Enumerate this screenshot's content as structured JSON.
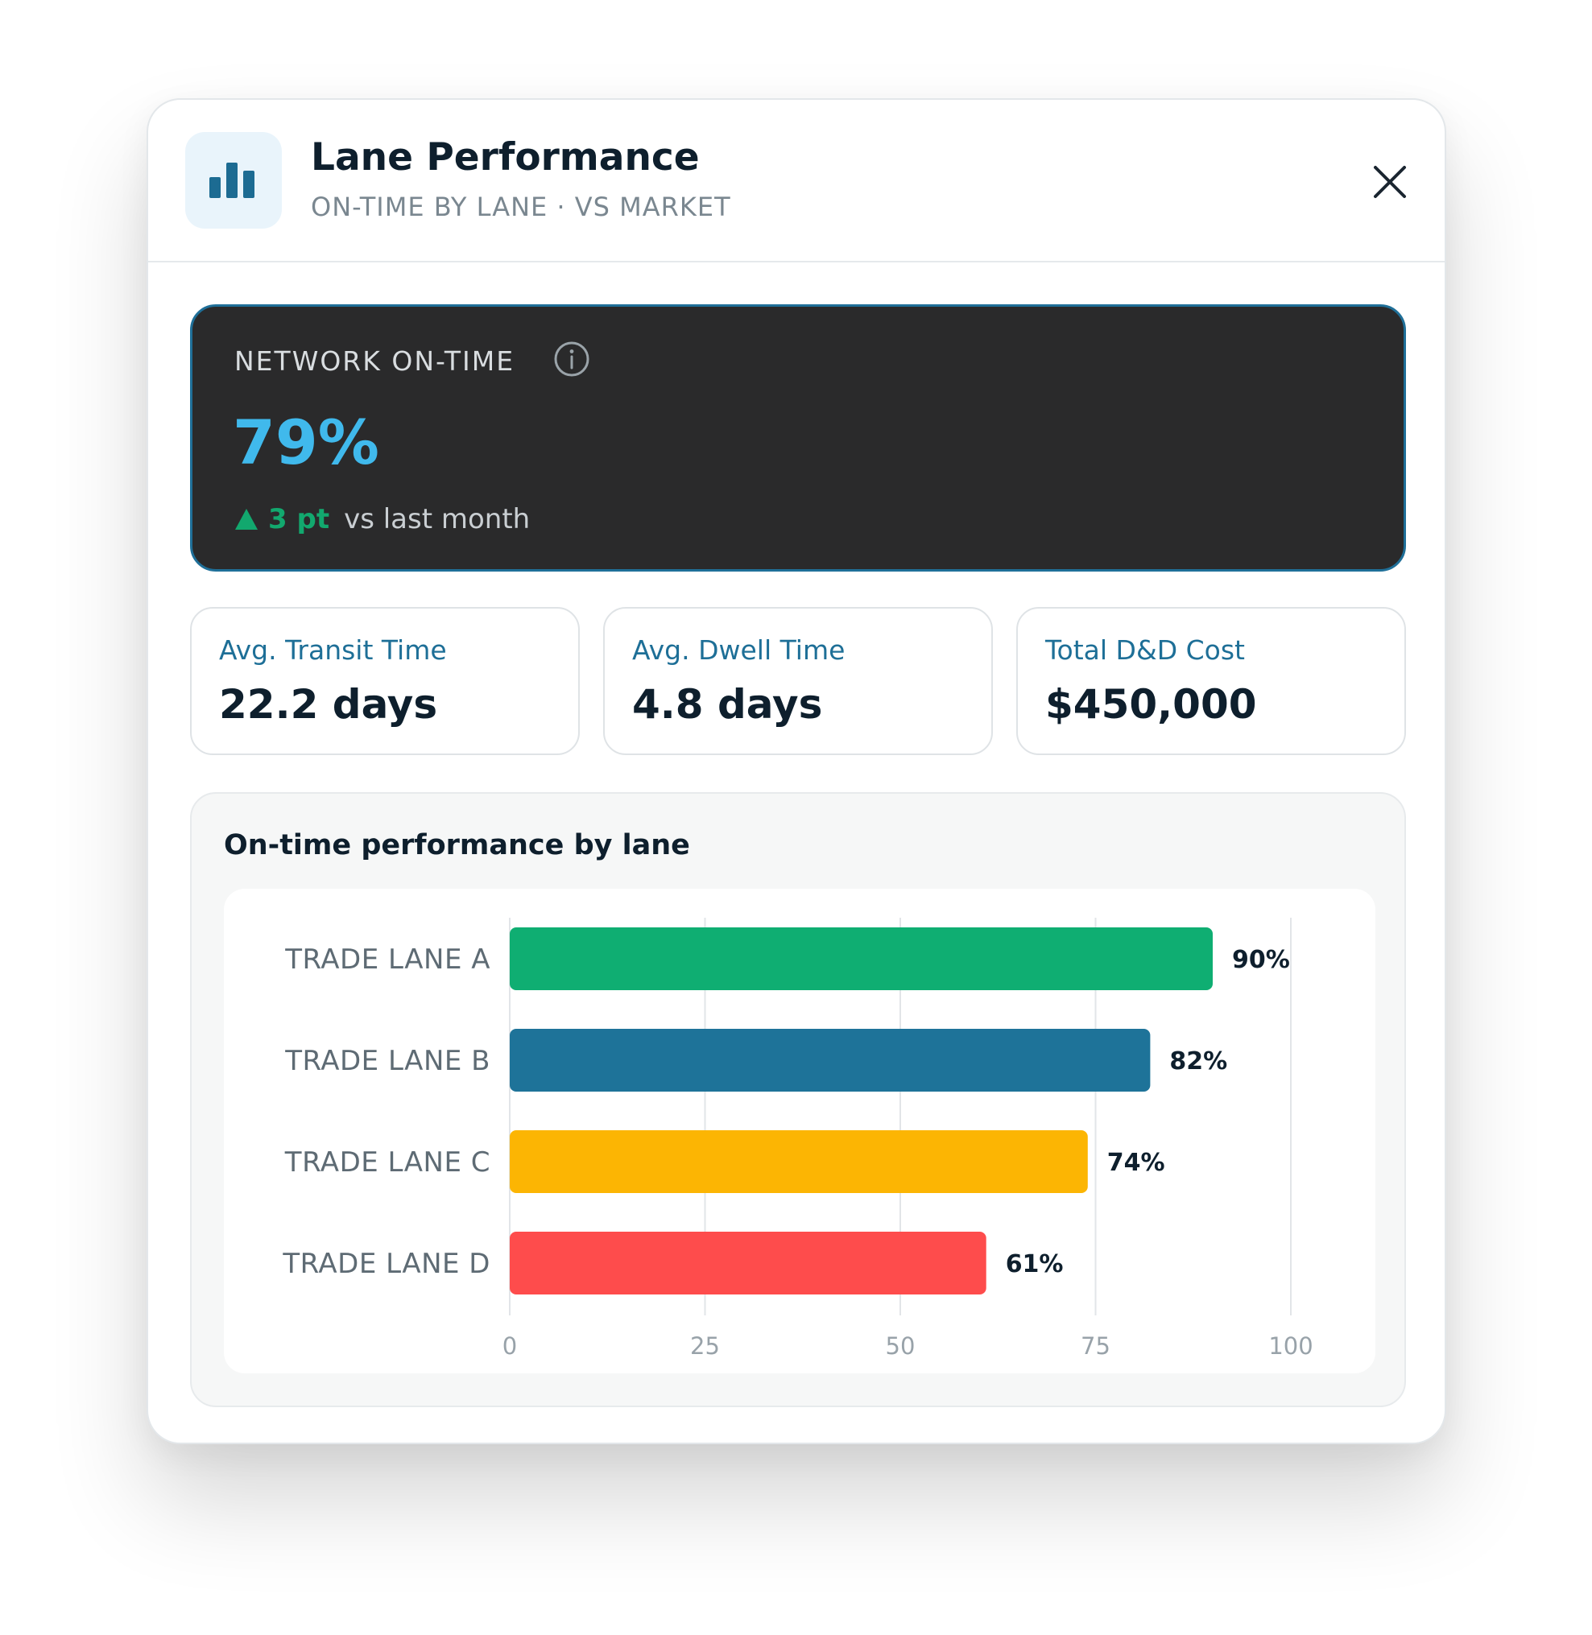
{
  "header": {
    "title": "Lane Performance",
    "subtitle": "ON-TIME BY LANE · VS MARKET",
    "icon": "bar-chart-icon",
    "close_icon": "close-icon"
  },
  "hero": {
    "label": "NETWORK ON-TIME",
    "value": "79%",
    "delta": "3 pt",
    "delta_note": "vs last month",
    "delta_direction": "up",
    "colors": {
      "value": "#40b9ec",
      "delta": "#12a86e",
      "background": "#2a2a2b"
    }
  },
  "stats": [
    {
      "label": "Avg. Transit Time",
      "value": "22.2 days"
    },
    {
      "label": "Avg. Dwell Time",
      "value": "4.8 days"
    },
    {
      "label": "Total D&D Cost",
      "value": "$450,000"
    }
  ],
  "chart_section": {
    "title": "On-time performance by lane"
  },
  "chart_data": {
    "type": "bar",
    "orientation": "horizontal",
    "categories": [
      "TRADE LANE A",
      "TRADE LANE B",
      "TRADE LANE C",
      "TRADE LANE D"
    ],
    "values": [
      90,
      82,
      74,
      61
    ],
    "value_labels": [
      "90%",
      "82%",
      "74%",
      "61%"
    ],
    "colors": [
      "#0fae72",
      "#1e7399",
      "#fcb503",
      "#fe4c4c"
    ],
    "xticks": [
      "0",
      "25",
      "50",
      "75",
      "100"
    ],
    "xlim": [
      0,
      100
    ],
    "grid": true,
    "title": "",
    "xlabel": "",
    "ylabel": ""
  }
}
